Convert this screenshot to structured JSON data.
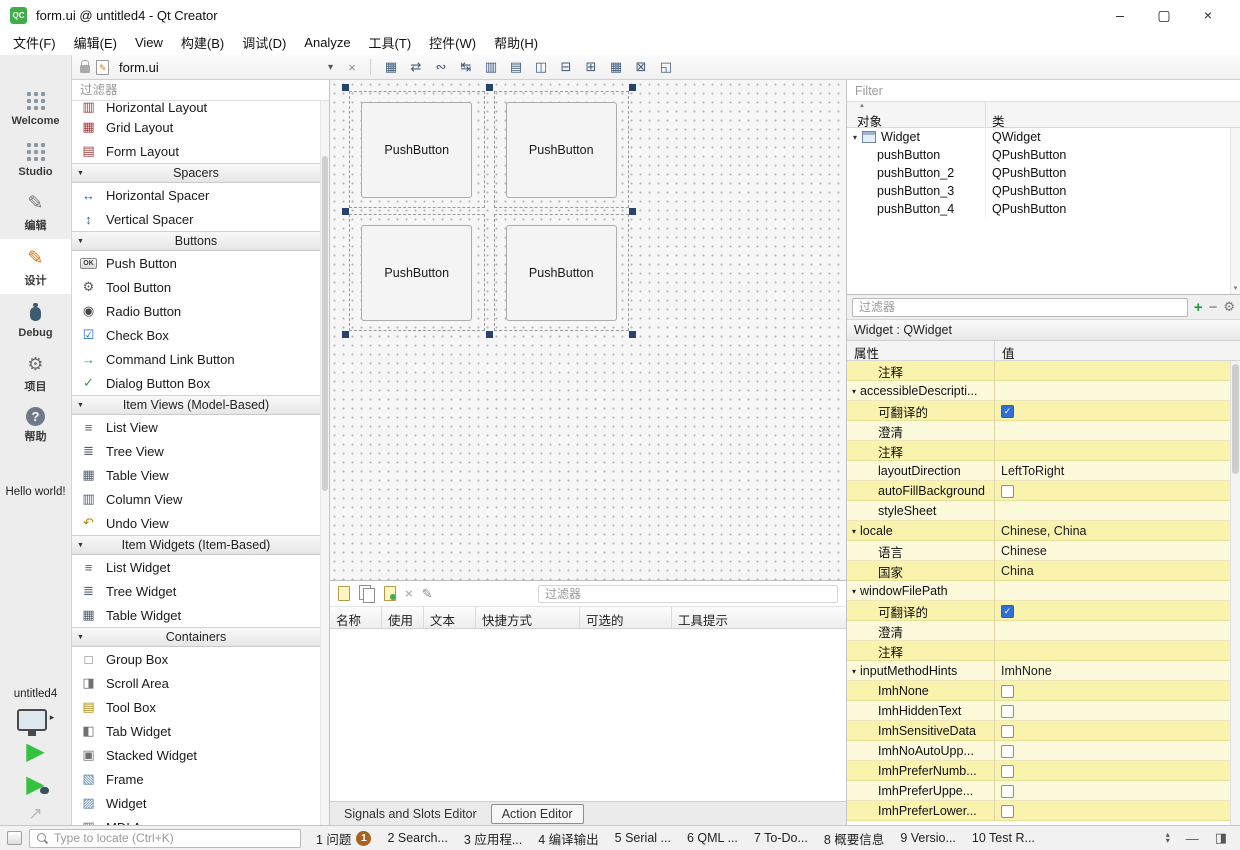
{
  "window": {
    "title": "form.ui @ untitled4 - Qt Creator"
  },
  "icons": {
    "logo_text": "QC",
    "minimize": "–",
    "maximize": "▢",
    "close": "×",
    "dropdown_arrow": "▾",
    "close_document": "×",
    "collapse_arrow": "▼",
    "expanded": "▾",
    "check": "✓",
    "run": "▶",
    "kit_arrow": "▸",
    "plus": "+",
    "minus": "−",
    "config": "⚙",
    "delete_x": "×",
    "edit_pencil": "✎",
    "pane_up": "▴",
    "pane_down": "▾",
    "minimize_panes": "—",
    "right_sidebar": "◨",
    "sort_asc": "▲",
    "analyze_arrow": "↗"
  },
  "menu_bar": {
    "items": [
      "文件(F)",
      "编辑(E)",
      "View",
      "构建(B)",
      "调试(D)",
      "Analyze",
      "工具(T)",
      "控件(W)",
      "帮助(H)"
    ]
  },
  "toolbar": {
    "document": "form.ui",
    "actions": [
      {
        "name": "edit-widgets",
        "glyph": "▦"
      },
      {
        "name": "edit-signals-slots",
        "glyph": "⇄"
      },
      {
        "name": "edit-buddies",
        "glyph": "∾"
      },
      {
        "name": "edit-tab-order",
        "glyph": "↹"
      },
      {
        "name": "lay-out-horizontally",
        "glyph": "▥"
      },
      {
        "name": "lay-out-vertically",
        "glyph": "▤"
      },
      {
        "name": "lay-out-horizontally-in-splitter",
        "glyph": "◫"
      },
      {
        "name": "lay-out-vertically-in-splitter",
        "glyph": "⊟"
      },
      {
        "name": "lay-out-in-form-layout",
        "glyph": "⊞"
      },
      {
        "name": "lay-out-in-grid",
        "glyph": "▦"
      },
      {
        "name": "break-layout",
        "glyph": "⊠"
      },
      {
        "name": "adjust-size",
        "glyph": "◱"
      }
    ]
  },
  "mode_sidebar": {
    "hello_text": "Hello world!",
    "project_name": "untitled4",
    "modes": [
      {
        "id": "welcome",
        "label": "Welcome",
        "icon": "welcome-icon",
        "glyph": "",
        "active": false
      },
      {
        "id": "studio",
        "label": "Studio",
        "icon": "studio-icon",
        "glyph": "",
        "active": false
      },
      {
        "id": "edit",
        "label": "编辑",
        "icon": "edit-icon",
        "glyph": "✎",
        "active": false
      },
      {
        "id": "design",
        "label": "设计",
        "icon": "design-icon",
        "glyph": "✎",
        "active": true
      },
      {
        "id": "debug",
        "label": "Debug",
        "icon": "debug-icon",
        "glyph": "",
        "active": false
      },
      {
        "id": "projects",
        "label": "项目",
        "icon": "projects-icon",
        "glyph": "⚙",
        "active": false
      },
      {
        "id": "help",
        "label": "帮助",
        "icon": "help-icon",
        "glyph": "?",
        "active": false
      }
    ]
  },
  "widget_box": {
    "filter_placeholder": "过滤器",
    "groups": [
      {
        "header": null,
        "items": [
          {
            "label": "Horizontal Layout",
            "icon": "horizontal-layout-icon",
            "glyph": "▥",
            "color": "#a33c3c",
            "clipped": true
          },
          {
            "label": "Grid Layout",
            "icon": "grid-layout-icon",
            "glyph": "▦",
            "color": "#a33c3c"
          },
          {
            "label": "Form Layout",
            "icon": "form-layout-icon",
            "glyph": "▤",
            "color": "#a33c3c"
          }
        ]
      },
      {
        "header": "Spacers",
        "items": [
          {
            "label": "Horizontal Spacer",
            "icon": "horizontal-spacer-icon",
            "glyph": "↔",
            "color": "#2b6cb0"
          },
          {
            "label": "Vertical Spacer",
            "icon": "vertical-spacer-icon",
            "glyph": "↕",
            "color": "#2b6cb0"
          }
        ]
      },
      {
        "header": "Buttons",
        "items": [
          {
            "label": "Push Button",
            "icon": "push-button-icon",
            "glyph": "OK",
            "color": "#333333"
          },
          {
            "label": "Tool Button",
            "icon": "tool-button-icon",
            "glyph": "⚙",
            "color": "#5a5a5a"
          },
          {
            "label": "Radio Button",
            "icon": "radio-button-icon",
            "glyph": "◉",
            "color": "#444444"
          },
          {
            "label": "Check Box",
            "icon": "check-box-icon",
            "glyph": "☑",
            "color": "#1b6ac9"
          },
          {
            "label": "Command Link Button",
            "icon": "command-link-button-icon",
            "glyph": "→",
            "color": "#2f9e44"
          },
          {
            "label": "Dialog Button Box",
            "icon": "dialog-button-box-icon",
            "glyph": "✓",
            "color": "#2f9e44"
          }
        ]
      },
      {
        "header": "Item Views (Model-Based)",
        "items": [
          {
            "label": "List View",
            "icon": "list-view-icon",
            "glyph": "≡",
            "color": "#55606e"
          },
          {
            "label": "Tree View",
            "icon": "tree-view-icon",
            "glyph": "≣",
            "color": "#55606e"
          },
          {
            "label": "Table View",
            "icon": "table-view-icon",
            "glyph": "▦",
            "color": "#55606e"
          },
          {
            "label": "Column View",
            "icon": "column-view-icon",
            "glyph": "▥",
            "color": "#55606e"
          },
          {
            "label": "Undo View",
            "icon": "undo-view-icon",
            "glyph": "↶",
            "color": "#b8860b"
          }
        ]
      },
      {
        "header": "Item Widgets (Item-Based)",
        "items": [
          {
            "label": "List Widget",
            "icon": "list-widget-icon",
            "glyph": "≡",
            "color": "#55606e"
          },
          {
            "label": "Tree Widget",
            "icon": "tree-widget-icon",
            "glyph": "≣",
            "color": "#55606e"
          },
          {
            "label": "Table Widget",
            "icon": "table-widget-icon",
            "glyph": "▦",
            "color": "#55606e"
          }
        ]
      },
      {
        "header": "Containers",
        "items": [
          {
            "label": "Group Box",
            "icon": "group-box-icon",
            "glyph": "□",
            "color": "#707070"
          },
          {
            "label": "Scroll Area",
            "icon": "scroll-area-icon",
            "glyph": "◨",
            "color": "#707070"
          },
          {
            "label": "Tool Box",
            "icon": "tool-box-icon",
            "glyph": "▤",
            "color": "#b8860b"
          },
          {
            "label": "Tab Widget",
            "icon": "tab-widget-icon",
            "glyph": "◧",
            "color": "#707070"
          },
          {
            "label": "Stacked Widget",
            "icon": "stacked-widget-icon",
            "glyph": "▣",
            "color": "#707070"
          },
          {
            "label": "Frame",
            "icon": "frame-icon",
            "glyph": "▧",
            "color": "#5b84b1"
          },
          {
            "label": "Widget",
            "icon": "widget-icon",
            "glyph": "▨",
            "color": "#5b84b1"
          },
          {
            "label": "MDI Area",
            "icon": "mdi-area-icon",
            "glyph": "▥",
            "color": "#707070"
          }
        ]
      }
    ]
  },
  "canvas": {
    "buttons": [
      "PushButton",
      "PushButton",
      "PushButton",
      "PushButton"
    ]
  },
  "action_editor": {
    "filter_placeholder": "过滤器",
    "columns": [
      "名称",
      "使用",
      "文本",
      "快捷方式",
      "可选的",
      "工具提示"
    ],
    "tabs": [
      {
        "label": "Signals and Slots Editor",
        "active": false
      },
      {
        "label": "Action Editor",
        "active": true
      }
    ]
  },
  "object_inspector": {
    "filter_placeholder": "Filter",
    "columns": [
      "对象",
      "类"
    ],
    "rows": [
      {
        "object": "Widget",
        "class": "QWidget",
        "level": 0,
        "expanded": true,
        "widget_icon": true
      },
      {
        "object": "pushButton",
        "class": "QPushButton",
        "level": 1
      },
      {
        "object": "pushButton_2",
        "class": "QPushButton",
        "level": 1
      },
      {
        "object": "pushButton_3",
        "class": "QPushButton",
        "level": 1
      },
      {
        "object": "pushButton_4",
        "class": "QPushButton",
        "level": 1
      }
    ]
  },
  "property_editor": {
    "filter_placeholder": "过滤器",
    "selection_label": "Widget : QWidget",
    "columns": [
      "属性",
      "值"
    ],
    "rows": [
      {
        "name": "注释"
      },
      {
        "name": "accessibleDescripti...",
        "expand": true
      },
      {
        "name": "可翻译的",
        "type": "checkbox",
        "checked": true
      },
      {
        "name": "澄清"
      },
      {
        "name": "注释"
      },
      {
        "name": "layoutDirection",
        "value": "LeftToRight"
      },
      {
        "name": "autoFillBackground",
        "type": "checkbox",
        "checked": false
      },
      {
        "name": "styleSheet"
      },
      {
        "name": "locale",
        "value": "Chinese, China",
        "expand": true
      },
      {
        "name": "语言",
        "value": "Chinese"
      },
      {
        "name": "国家",
        "value": "China"
      },
      {
        "name": "windowFilePath",
        "expand": true
      },
      {
        "name": "可翻译的",
        "type": "checkbox",
        "checked": true
      },
      {
        "name": "澄清"
      },
      {
        "name": "注释"
      },
      {
        "name": "inputMethodHints",
        "value": "ImhNone",
        "expand": true
      },
      {
        "name": "ImhNone",
        "type": "checkbox",
        "checked": false
      },
      {
        "name": "ImhHiddenText",
        "type": "checkbox",
        "checked": false
      },
      {
        "name": "ImhSensitiveData",
        "type": "checkbox",
        "checked": false
      },
      {
        "name": "ImhNoAutoUpp...",
        "type": "checkbox",
        "checked": false
      },
      {
        "name": "ImhPreferNumb...",
        "type": "checkbox",
        "checked": false
      },
      {
        "name": "ImhPreferUppe...",
        "type": "checkbox",
        "checked": false
      },
      {
        "name": "ImhPreferLower...",
        "type": "checkbox",
        "checked": false
      }
    ]
  },
  "status_bar": {
    "locator_placeholder": "Type to locate (Ctrl+K)",
    "panes": [
      {
        "label": "1 问题",
        "badge": "1"
      },
      {
        "label": "2 Search..."
      },
      {
        "label": "3 应用程..."
      },
      {
        "label": "4 编译输出"
      },
      {
        "label": "5 Serial ..."
      },
      {
        "label": "6 QML ..."
      },
      {
        "label": "7 To-Do..."
      },
      {
        "label": "8 概要信息"
      },
      {
        "label": "9 Versio..."
      },
      {
        "label": "10 Test R..."
      }
    ]
  }
}
